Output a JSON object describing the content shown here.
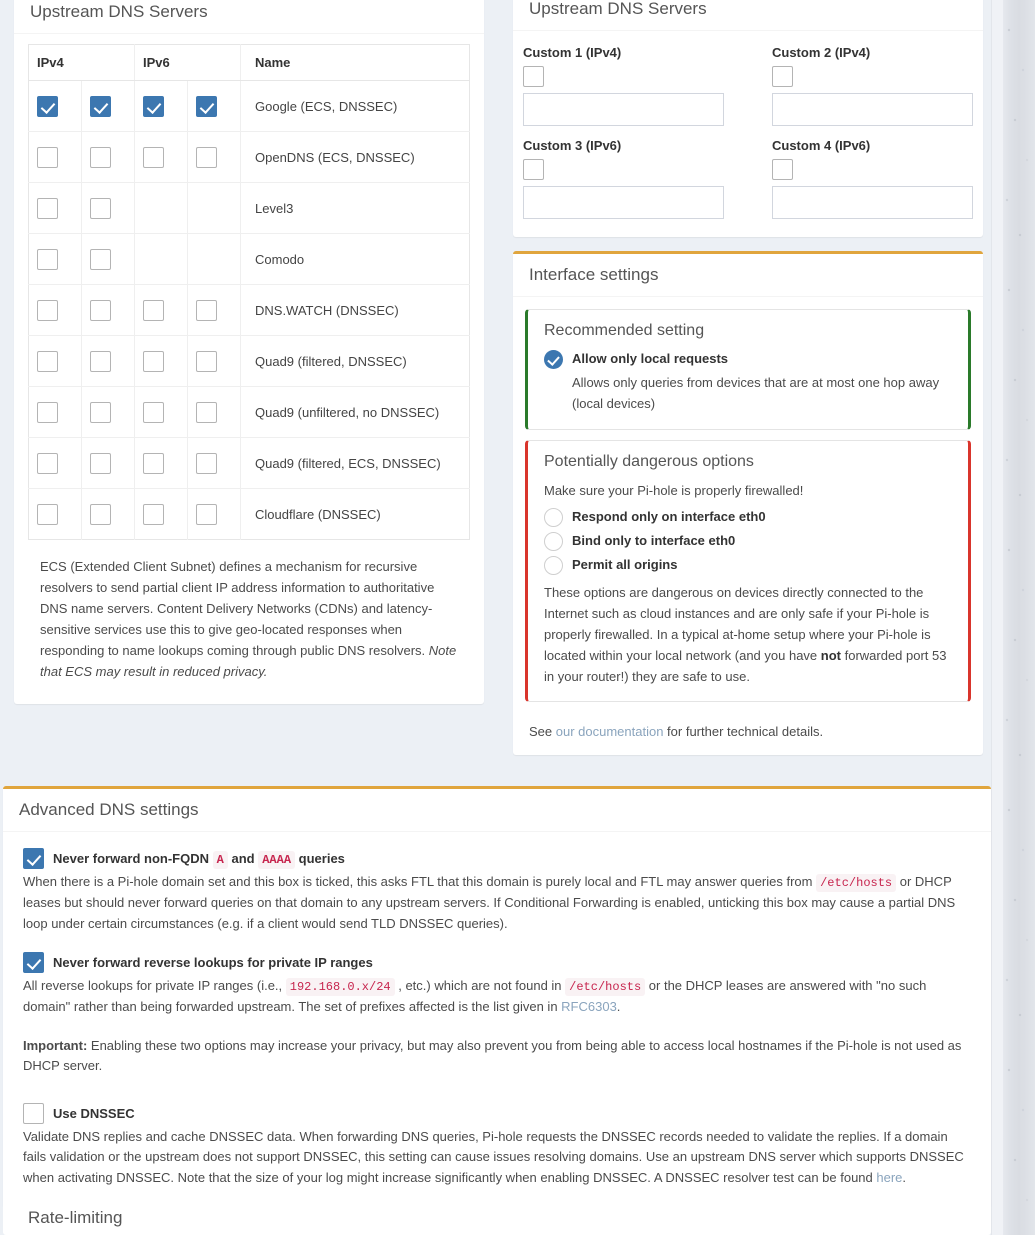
{
  "upstream_table_panel": {
    "title": "Upstream DNS Servers",
    "columns": [
      "IPv4",
      "IPv6",
      "Name"
    ],
    "rows": [
      {
        "name": "Google (ECS, DNSSEC)",
        "checks": [
          true,
          true,
          true,
          true
        ],
        "has_ipv6": true
      },
      {
        "name": "OpenDNS (ECS, DNSSEC)",
        "checks": [
          false,
          false,
          false,
          false
        ],
        "has_ipv6": true
      },
      {
        "name": "Level3",
        "checks": [
          false,
          false,
          null,
          null
        ],
        "has_ipv6": false
      },
      {
        "name": "Comodo",
        "checks": [
          false,
          false,
          null,
          null
        ],
        "has_ipv6": false
      },
      {
        "name": "DNS.WATCH (DNSSEC)",
        "checks": [
          false,
          false,
          false,
          false
        ],
        "has_ipv6": true
      },
      {
        "name": "Quad9 (filtered, DNSSEC)",
        "checks": [
          false,
          false,
          false,
          false
        ],
        "has_ipv6": true
      },
      {
        "name": "Quad9 (unfiltered, no DNSSEC)",
        "checks": [
          false,
          false,
          false,
          false
        ],
        "has_ipv6": true
      },
      {
        "name": "Quad9 (filtered, ECS, DNSSEC)",
        "checks": [
          false,
          false,
          false,
          false
        ],
        "has_ipv6": true
      },
      {
        "name": "Cloudflare (DNSSEC)",
        "checks": [
          false,
          false,
          false,
          false
        ],
        "has_ipv6": true
      }
    ],
    "ecs_note_plain": "ECS (Extended Client Subnet) defines a mechanism for recursive resolvers to send partial client IP address information to authoritative DNS name servers. Content Delivery Networks (CDNs) and latency-sensitive services use this to give geo-located responses when responding to name lookups coming through public DNS resolvers.",
    "ecs_note_italic": "Note that ECS may result in reduced privacy."
  },
  "custom_panel": {
    "title": "Upstream DNS Servers",
    "fields": [
      {
        "label": "Custom 1 (IPv4)",
        "checked": false,
        "value": "",
        "placeholder": ""
      },
      {
        "label": "Custom 2 (IPv4)",
        "checked": false,
        "value": "",
        "placeholder": ""
      },
      {
        "label": "Custom 3 (IPv6)",
        "checked": false,
        "value": "",
        "placeholder": ""
      },
      {
        "label": "Custom 4 (IPv6)",
        "checked": false,
        "value": "",
        "placeholder": ""
      }
    ]
  },
  "interface_panel": {
    "title": "Interface settings",
    "recommended": {
      "title": "Recommended setting",
      "option_label": "Allow only local requests",
      "option_selected": true,
      "option_desc": "Allows only queries from devices that are at most one hop away (local devices)"
    },
    "dangerous": {
      "title": "Potentially dangerous options",
      "warning": "Make sure your Pi-hole is properly firewalled!",
      "options": [
        {
          "label": "Respond only on interface eth0",
          "selected": false
        },
        {
          "label": "Bind only to interface eth0",
          "selected": false
        },
        {
          "label": "Permit all origins",
          "selected": false
        }
      ],
      "desc_part1": "These options are dangerous on devices directly connected to the Internet such as cloud instances and are only safe if your Pi-hole is properly firewalled. In a typical at-home setup where your Pi-hole is located within your local network (and you have ",
      "desc_bold": "not",
      "desc_part2": " forwarded port 53 in your router!) they are safe to use."
    },
    "footer": {
      "pre": "See ",
      "link": "our documentation",
      "post": " for further technical details."
    }
  },
  "advanced_panel": {
    "title": "Advanced DNS settings",
    "opt_fqdn": {
      "checked": true,
      "label_a": "Never forward non-FQDN",
      "code_a": "A",
      "label_and": "and",
      "code_aaaa": "AAAA",
      "label_b": "queries",
      "desc_1": "When there is a Pi-hole domain set and this box is ticked, this asks FTL that this domain is purely local and FTL may answer queries from ",
      "code_hosts": "/etc/hosts",
      "desc_2": " or DHCP leases but should never forward queries on that domain to any upstream servers. If Conditional Forwarding is enabled, unticking this box may cause a partial DNS loop under certain circumstances (e.g. if a client would send TLD DNSSEC queries)."
    },
    "opt_reverse": {
      "checked": true,
      "label": "Never forward reverse lookups for private IP ranges",
      "desc_1": "All reverse lookups for private IP ranges (i.e., ",
      "code_ip": "192.168.0.x/24",
      "desc_2": " , etc.) which are not found in ",
      "code_hosts": "/etc/hosts",
      "desc_3": " or the DHCP leases are answered with \"no such domain\" rather than being forwarded upstream. The set of prefixes affected is the list given in ",
      "link_rfc": "RFC6303",
      "desc_4": "."
    },
    "important": {
      "bold": "Important:",
      "text": " Enabling these two options may increase your privacy, but may also prevent you from being able to access local hostnames if the Pi-hole is not used as DHCP server."
    },
    "opt_dnssec": {
      "checked": false,
      "label": "Use DNSSEC",
      "desc_1": "Validate DNS replies and cache DNSSEC data. When forwarding DNS queries, Pi-hole requests the DNSSEC records needed to validate the replies. If a domain fails validation or the upstream does not support DNSSEC, this setting can cause issues resolving domains. Use an upstream DNS server which supports DNSSEC when activating DNSSEC. Note that the size of your log might increase significantly when enabling DNSSEC. A DNSSEC resolver test can be found ",
      "link_here": "here",
      "desc_2": "."
    }
  },
  "rate_limiting_panel": {
    "title": "Rate-limiting"
  },
  "colors": {
    "accent_blue": "#3c77b0",
    "panel_top_orange": "#e0a53d",
    "recommended_green": "#2a7a2a",
    "danger_red": "#d9352c",
    "link_blue": "#8aa4bd",
    "code_pink_bg": "#f9f2f4",
    "code_text": "#c7254e",
    "page_bg": "#ecf0f5"
  }
}
